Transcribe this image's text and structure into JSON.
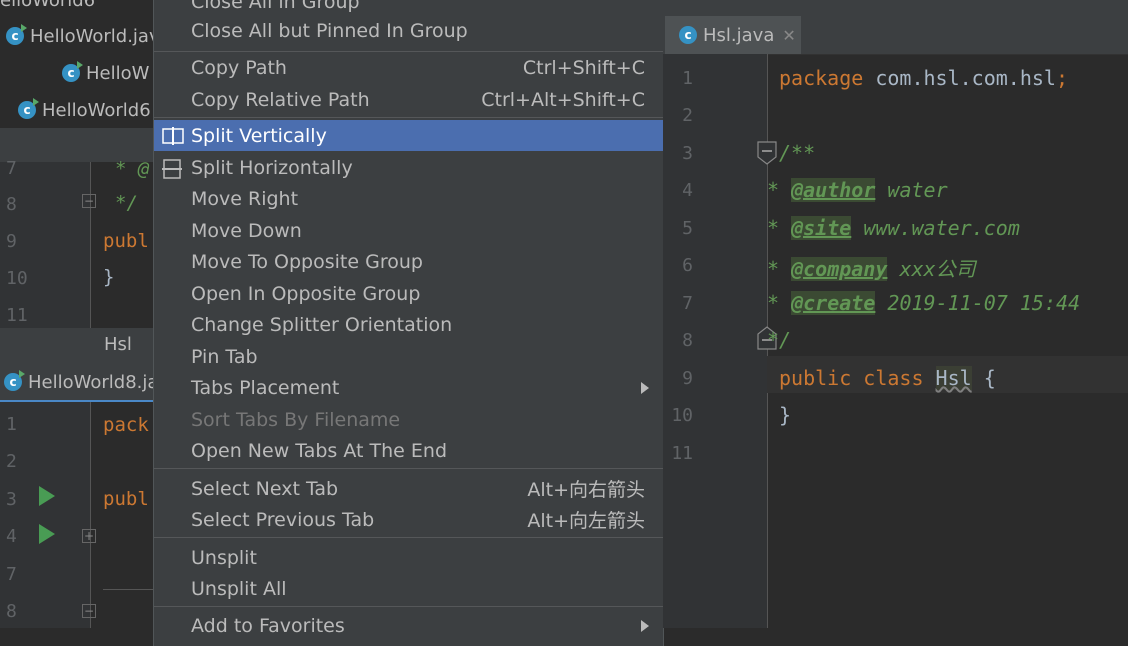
{
  "left_editor": {
    "tabs": [
      {
        "label": "elloWorld6"
      },
      {
        "label": "HelloWorld.java"
      },
      {
        "label": "HelloW"
      },
      {
        "label": "HelloWorld6"
      }
    ],
    "top_lines": [
      {
        "num": "7",
        "code": "* @"
      },
      {
        "num": "8",
        "code": "*/"
      },
      {
        "num": "9",
        "code": "publ"
      },
      {
        "num": "10",
        "code": "}"
      },
      {
        "num": "11",
        "code": ""
      }
    ],
    "split_label": "Hsl",
    "bottom_tab": "HelloWorld8.ja",
    "bottom_lines": [
      {
        "num": "1",
        "code": "pack"
      },
      {
        "num": "2",
        "code": ""
      },
      {
        "num": "3",
        "code": "publ"
      },
      {
        "num": "4",
        "code": ""
      },
      {
        "num": "7",
        "code": ""
      },
      {
        "num": "8",
        "code": ""
      }
    ]
  },
  "menu": {
    "items": [
      {
        "label": "Close All in Group",
        "shortcut": ""
      },
      {
        "label": "Close All but Pinned In Group",
        "shortcut": ""
      },
      {
        "label": "Copy Path",
        "shortcut": "Ctrl+Shift+C"
      },
      {
        "label": "Copy Relative Path",
        "shortcut": "Ctrl+Alt+Shift+C"
      },
      {
        "label": "Split Vertically",
        "shortcut": ""
      },
      {
        "label": "Split Horizontally",
        "shortcut": ""
      },
      {
        "label": "Move Right",
        "shortcut": ""
      },
      {
        "label": "Move Down",
        "shortcut": ""
      },
      {
        "label": "Move To Opposite Group",
        "shortcut": ""
      },
      {
        "label": "Open In Opposite Group",
        "shortcut": ""
      },
      {
        "label": "Change Splitter Orientation",
        "shortcut": ""
      },
      {
        "label": "Pin Tab",
        "shortcut": ""
      },
      {
        "label": "Tabs Placement",
        "shortcut": ""
      },
      {
        "label": "Sort Tabs By Filename",
        "shortcut": ""
      },
      {
        "label": "Open New Tabs At The End",
        "shortcut": ""
      },
      {
        "label": "Select Next Tab",
        "shortcut": "Alt+向右箭头"
      },
      {
        "label": "Select Previous Tab",
        "shortcut": "Alt+向左箭头"
      },
      {
        "label": "Unsplit",
        "shortcut": ""
      },
      {
        "label": "Unsplit All",
        "shortcut": ""
      },
      {
        "label": "Add to Favorites",
        "shortcut": ""
      }
    ]
  },
  "right_editor": {
    "tab_label": "Hsl.java",
    "lines": [
      {
        "num": "1"
      },
      {
        "num": "2"
      },
      {
        "num": "3"
      },
      {
        "num": "4"
      },
      {
        "num": "5"
      },
      {
        "num": "6"
      },
      {
        "num": "7"
      },
      {
        "num": "8"
      },
      {
        "num": "9"
      },
      {
        "num": "10"
      },
      {
        "num": "11"
      }
    ],
    "code": {
      "package_kw": "package",
      "package_name": " com.hsl.com.hsl",
      "semicolon": ";",
      "doc_open": "/**",
      "star": " * ",
      "author_tag": "@author",
      "author_val": " water",
      "site_tag": "@site",
      "site_val": " www.water.com",
      "company_tag": "@company",
      "company_val": " xxx公司",
      "create_tag": "@create",
      "create_val": " 2019-11-07 15:44",
      "doc_close": " */",
      "public_class": "public class ",
      "class_name": "Hsl",
      "open_brace": " {",
      "close_brace": "}"
    }
  },
  "colors": {
    "selected": "#4b6eaf",
    "keyword": "#cc7832",
    "comment": "#629755"
  }
}
